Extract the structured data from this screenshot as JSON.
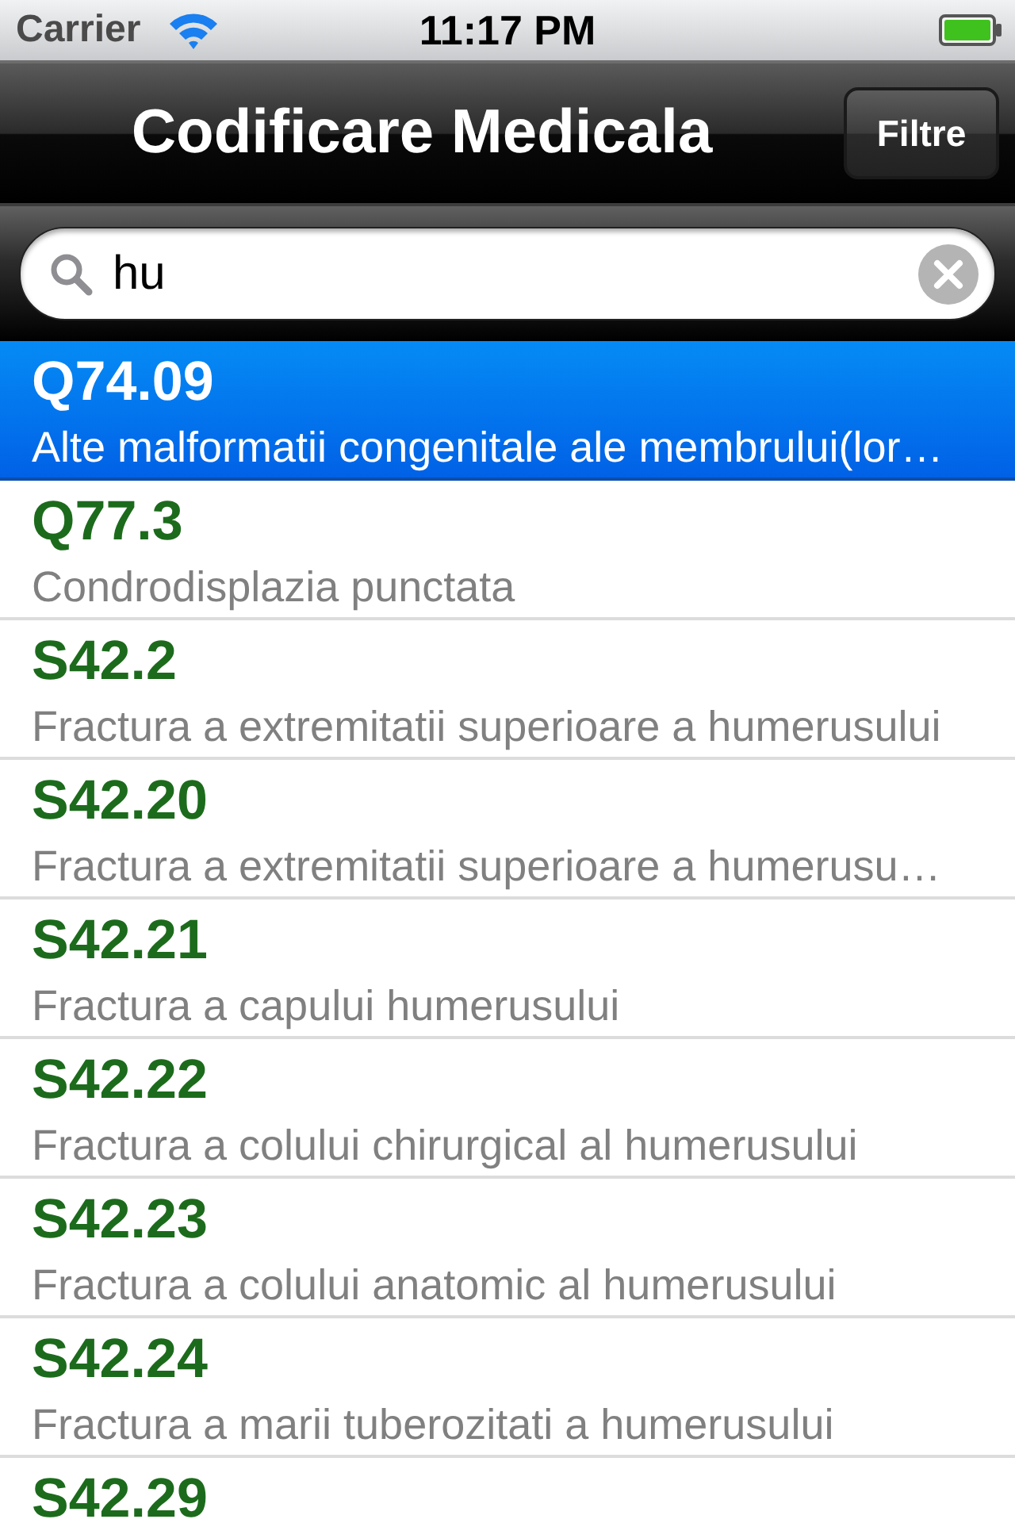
{
  "status_bar": {
    "carrier": "Carrier",
    "time": "11:17 PM"
  },
  "nav_bar": {
    "title": "Codificare Medicala",
    "button": "Filtre"
  },
  "search": {
    "value": "hu"
  },
  "results": [
    {
      "code": "Q74.09",
      "description": "Alte malformatii congenitale ale membrului(lor…",
      "selected": true
    },
    {
      "code": "Q77.3",
      "description": "Condrodisplazia punctata",
      "selected": false
    },
    {
      "code": "S42.2",
      "description": "Fractura a extremitatii superioare a humerusului",
      "selected": false
    },
    {
      "code": "S42.20",
      "description": "Fractura a extremitatii superioare a humerusu…",
      "selected": false
    },
    {
      "code": "S42.21",
      "description": "Fractura a capului humerusului",
      "selected": false
    },
    {
      "code": "S42.22",
      "description": "Fractura a colului chirurgical al humerusului",
      "selected": false
    },
    {
      "code": "S42.23",
      "description": "Fractura a colului anatomic al humerusului",
      "selected": false
    },
    {
      "code": "S42.24",
      "description": "Fractura a marii tuberozitati a humerusului",
      "selected": false
    },
    {
      "code": "S42.29",
      "selected": false
    }
  ]
}
